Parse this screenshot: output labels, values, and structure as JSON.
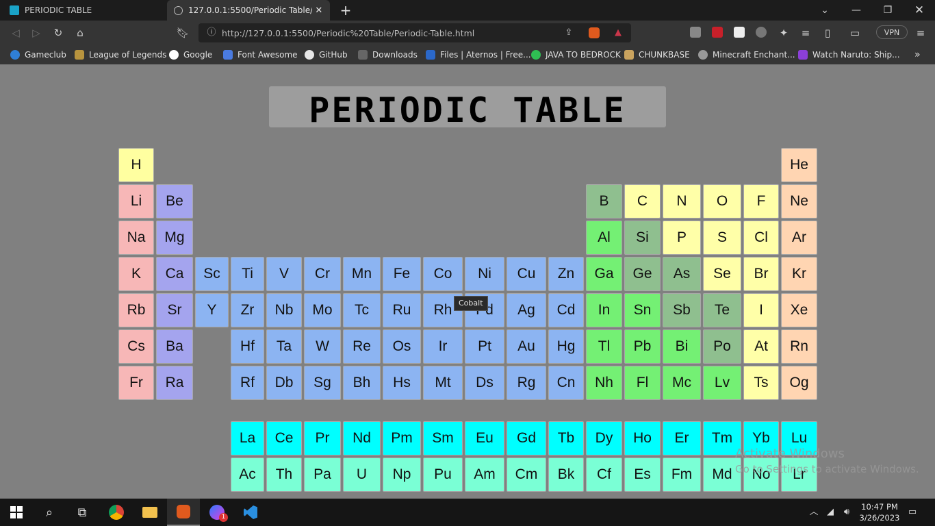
{
  "browser": {
    "tabs": [
      {
        "title": "PERIODIC TABLE",
        "active": false
      },
      {
        "title": "127.0.0.1:5500/Periodic Table/Peri",
        "active": true
      }
    ],
    "url": "http://127.0.0.1:5500/Periodic%20Table/Periodic-Table.html",
    "vpn_label": "VPN",
    "bookmarks": [
      "Gameclub",
      "League of Legends",
      "Google",
      "Font Awesome",
      "GitHub",
      "Downloads",
      "Files | Aternos | Free...",
      "JAVA TO BEDROCK",
      "CHUNKBASE",
      "Minecraft Enchant...",
      "Watch Naruto: Ship..."
    ],
    "bookmarks_overflow": "»"
  },
  "page": {
    "title": "PERIODIC TABLE",
    "tooltip": "Cobalt",
    "watermark_line1": "Activate Windows",
    "watermark_line2": "Go to Settings to activate Windows."
  },
  "colors": {
    "hydrogen": "#ffffa0",
    "alkali": "#f7b7b7",
    "alkaline_earth": "#a4a4ee",
    "transition": "#8cb4f2",
    "post_transition": "#74f074",
    "metalloid": "#8fbf8f",
    "nonmetal": "#ffffa8",
    "noble": "#ffd5b2",
    "lanthanide": "#00ffff",
    "actinide": "#7affd5"
  },
  "elements": [
    {
      "s": "H",
      "c": "hydrogen"
    },
    {
      "s": "He",
      "c": "noble"
    },
    {
      "s": "Li",
      "c": "alkali"
    },
    {
      "s": "Be",
      "c": "alkaline_earth"
    },
    {
      "s": "B",
      "c": "metalloid"
    },
    {
      "s": "C",
      "c": "nonmetal"
    },
    {
      "s": "N",
      "c": "nonmetal"
    },
    {
      "s": "O",
      "c": "nonmetal"
    },
    {
      "s": "F",
      "c": "nonmetal"
    },
    {
      "s": "Ne",
      "c": "noble"
    },
    {
      "s": "Na",
      "c": "alkali"
    },
    {
      "s": "Mg",
      "c": "alkaline_earth"
    },
    {
      "s": "Al",
      "c": "post_transition"
    },
    {
      "s": "Si",
      "c": "metalloid"
    },
    {
      "s": "P",
      "c": "nonmetal"
    },
    {
      "s": "S",
      "c": "nonmetal"
    },
    {
      "s": "Cl",
      "c": "nonmetal"
    },
    {
      "s": "Ar",
      "c": "noble"
    },
    {
      "s": "K",
      "c": "alkali"
    },
    {
      "s": "Ca",
      "c": "alkaline_earth"
    },
    {
      "s": "Sc",
      "c": "transition"
    },
    {
      "s": "Ti",
      "c": "transition"
    },
    {
      "s": "V",
      "c": "transition"
    },
    {
      "s": "Cr",
      "c": "transition"
    },
    {
      "s": "Mn",
      "c": "transition"
    },
    {
      "s": "Fe",
      "c": "transition"
    },
    {
      "s": "Co",
      "c": "transition"
    },
    {
      "s": "Ni",
      "c": "transition"
    },
    {
      "s": "Cu",
      "c": "transition"
    },
    {
      "s": "Zn",
      "c": "transition"
    },
    {
      "s": "Ga",
      "c": "post_transition"
    },
    {
      "s": "Ge",
      "c": "metalloid"
    },
    {
      "s": "As",
      "c": "metalloid"
    },
    {
      "s": "Se",
      "c": "nonmetal"
    },
    {
      "s": "Br",
      "c": "nonmetal"
    },
    {
      "s": "Kr",
      "c": "noble"
    },
    {
      "s": "Rb",
      "c": "alkali"
    },
    {
      "s": "Sr",
      "c": "alkaline_earth"
    },
    {
      "s": "Y",
      "c": "transition"
    },
    {
      "s": "Zr",
      "c": "transition"
    },
    {
      "s": "Nb",
      "c": "transition"
    },
    {
      "s": "Mo",
      "c": "transition"
    },
    {
      "s": "Tc",
      "c": "transition"
    },
    {
      "s": "Ru",
      "c": "transition"
    },
    {
      "s": "Rh",
      "c": "transition"
    },
    {
      "s": "Pd",
      "c": "transition"
    },
    {
      "s": "Ag",
      "c": "transition"
    },
    {
      "s": "Cd",
      "c": "transition"
    },
    {
      "s": "In",
      "c": "post_transition"
    },
    {
      "s": "Sn",
      "c": "post_transition"
    },
    {
      "s": "Sb",
      "c": "metalloid"
    },
    {
      "s": "Te",
      "c": "metalloid"
    },
    {
      "s": "I",
      "c": "nonmetal"
    },
    {
      "s": "Xe",
      "c": "noble"
    },
    {
      "s": "Cs",
      "c": "alkali"
    },
    {
      "s": "Ba",
      "c": "alkaline_earth"
    },
    {
      "s": "Hf",
      "c": "transition"
    },
    {
      "s": "Ta",
      "c": "transition"
    },
    {
      "s": "W",
      "c": "transition"
    },
    {
      "s": "Re",
      "c": "transition"
    },
    {
      "s": "Os",
      "c": "transition"
    },
    {
      "s": "Ir",
      "c": "transition"
    },
    {
      "s": "Pt",
      "c": "transition"
    },
    {
      "s": "Au",
      "c": "transition"
    },
    {
      "s": "Hg",
      "c": "transition"
    },
    {
      "s": "Tl",
      "c": "post_transition"
    },
    {
      "s": "Pb",
      "c": "post_transition"
    },
    {
      "s": "Bi",
      "c": "post_transition"
    },
    {
      "s": "Po",
      "c": "metalloid"
    },
    {
      "s": "At",
      "c": "nonmetal"
    },
    {
      "s": "Rn",
      "c": "noble"
    },
    {
      "s": "Fr",
      "c": "alkali"
    },
    {
      "s": "Ra",
      "c": "alkaline_earth"
    },
    {
      "s": "Rf",
      "c": "transition"
    },
    {
      "s": "Db",
      "c": "transition"
    },
    {
      "s": "Sg",
      "c": "transition"
    },
    {
      "s": "Bh",
      "c": "transition"
    },
    {
      "s": "Hs",
      "c": "transition"
    },
    {
      "s": "Mt",
      "c": "transition"
    },
    {
      "s": "Ds",
      "c": "transition"
    },
    {
      "s": "Rg",
      "c": "transition"
    },
    {
      "s": "Cn",
      "c": "transition"
    },
    {
      "s": "Nh",
      "c": "post_transition"
    },
    {
      "s": "Fl",
      "c": "post_transition"
    },
    {
      "s": "Mc",
      "c": "post_transition"
    },
    {
      "s": "Lv",
      "c": "post_transition"
    },
    {
      "s": "Ts",
      "c": "nonmetal"
    },
    {
      "s": "Og",
      "c": "noble"
    },
    {
      "s": "La",
      "c": "lanthanide"
    },
    {
      "s": "Ce",
      "c": "lanthanide"
    },
    {
      "s": "Pr",
      "c": "lanthanide"
    },
    {
      "s": "Nd",
      "c": "lanthanide"
    },
    {
      "s": "Pm",
      "c": "lanthanide"
    },
    {
      "s": "Sm",
      "c": "lanthanide"
    },
    {
      "s": "Eu",
      "c": "lanthanide"
    },
    {
      "s": "Gd",
      "c": "lanthanide"
    },
    {
      "s": "Tb",
      "c": "lanthanide"
    },
    {
      "s": "Dy",
      "c": "lanthanide"
    },
    {
      "s": "Ho",
      "c": "lanthanide"
    },
    {
      "s": "Er",
      "c": "lanthanide"
    },
    {
      "s": "Tm",
      "c": "lanthanide"
    },
    {
      "s": "Yb",
      "c": "lanthanide"
    },
    {
      "s": "Lu",
      "c": "lanthanide"
    },
    {
      "s": "Ac",
      "c": "actinide"
    },
    {
      "s": "Th",
      "c": "actinide"
    },
    {
      "s": "Pa",
      "c": "actinide"
    },
    {
      "s": "U",
      "c": "actinide"
    },
    {
      "s": "Np",
      "c": "actinide"
    },
    {
      "s": "Pu",
      "c": "actinide"
    },
    {
      "s": "Am",
      "c": "actinide"
    },
    {
      "s": "Cm",
      "c": "actinide"
    },
    {
      "s": "Bk",
      "c": "actinide"
    },
    {
      "s": "Cf",
      "c": "actinide"
    },
    {
      "s": "Es",
      "c": "actinide"
    },
    {
      "s": "Fm",
      "c": "actinide"
    },
    {
      "s": "Md",
      "c": "actinide"
    },
    {
      "s": "No",
      "c": "actinide"
    },
    {
      "s": "Lr",
      "c": "actinide"
    }
  ],
  "taskbar": {
    "time": "10:47 PM",
    "date": "3/26/2023",
    "badge": "1"
  }
}
